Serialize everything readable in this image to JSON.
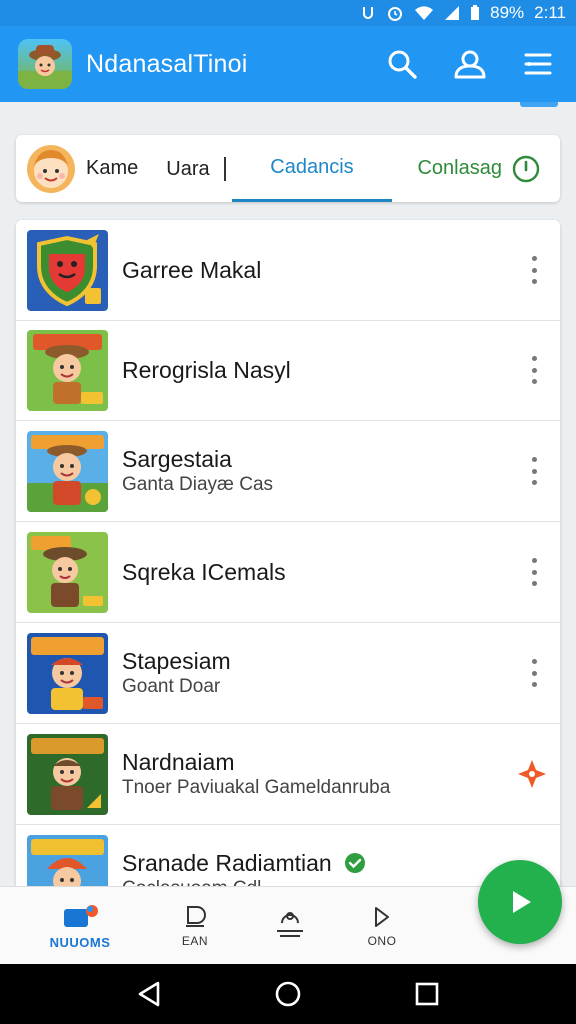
{
  "status_bar": {
    "battery": "89%",
    "time": "2:11"
  },
  "app_bar": {
    "title": "Ndanasal​Tinoi"
  },
  "filter": {
    "name_label": "Kame",
    "input_value": "Uara",
    "active_tab": "Cadancis",
    "status_label": "Conlasag"
  },
  "games": [
    {
      "title": "Garree Makal",
      "subtitle": ""
    },
    {
      "title": "Rerogrisla Nasyl",
      "subtitle": ""
    },
    {
      "title": "Sargestaia",
      "subtitle": "Ganta Diayæ Cas"
    },
    {
      "title": "Sqreka ICemals",
      "subtitle": ""
    },
    {
      "title": "Stapesiam",
      "subtitle": "Goant Doar"
    },
    {
      "title": "Nardnaiam",
      "subtitle": "Tnoer Paviuakal Gameldanruba"
    },
    {
      "title": "Sranade Radiamtian",
      "subtitle": "Coclasuoam Cdl"
    }
  ],
  "bottom_nav": [
    {
      "label": "NUUOMS"
    },
    {
      "label": "EAN"
    },
    {
      "label": ""
    },
    {
      "label": "ONO"
    }
  ],
  "colors": {
    "primary": "#2196f3",
    "accent_green": "#22b14c",
    "tab_blue": "#1e88c7",
    "status_green": "#2e8b3a"
  }
}
